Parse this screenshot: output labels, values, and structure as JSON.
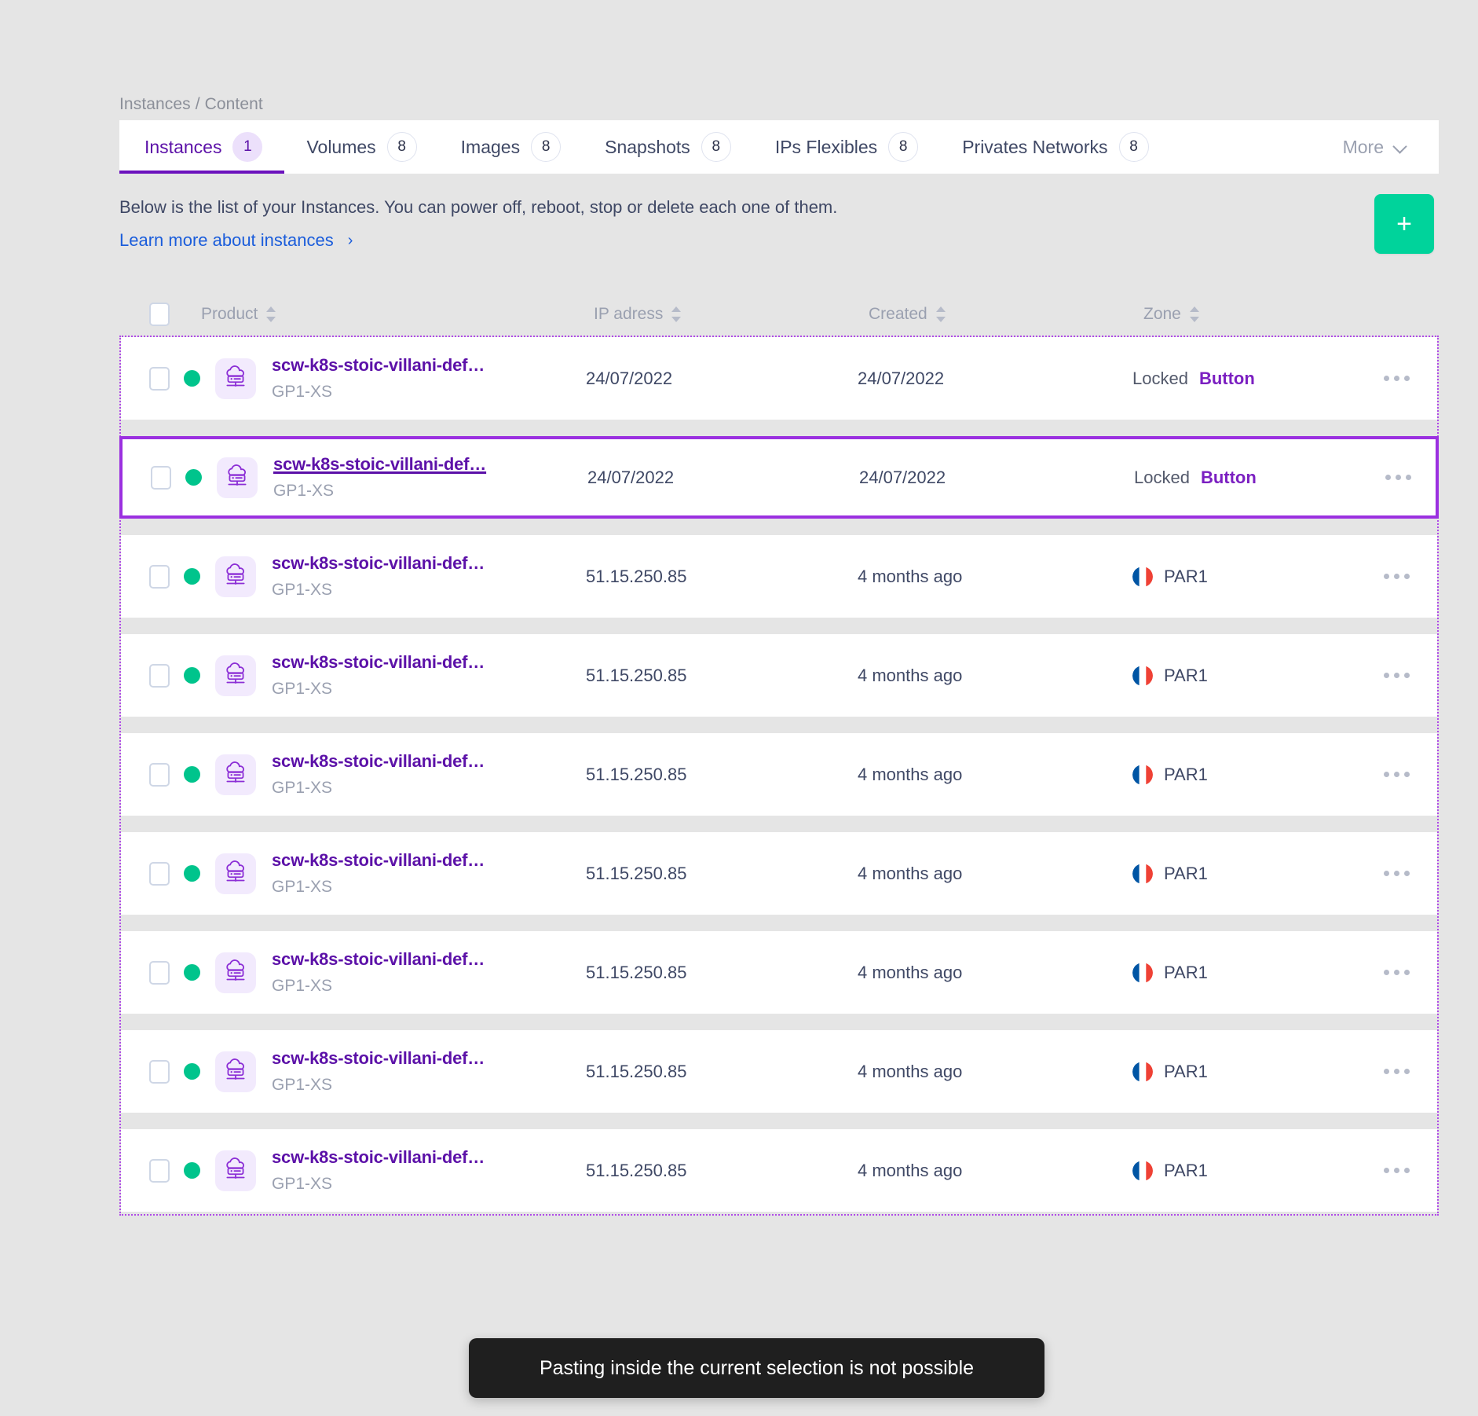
{
  "breadcrumb": "Instances / Content",
  "tabs": [
    {
      "label": "Instances",
      "count": "1",
      "active": true
    },
    {
      "label": "Volumes",
      "count": "8",
      "active": false
    },
    {
      "label": "Images",
      "count": "8",
      "active": false
    },
    {
      "label": "Snapshots",
      "count": "8",
      "active": false
    },
    {
      "label": "IPs Flexibles",
      "count": "8",
      "active": false
    },
    {
      "label": "Privates Networks",
      "count": "8",
      "active": false
    }
  ],
  "more_label": "More",
  "description": "Below is the list of your Instances. You can power off, reboot, stop or delete each one of them.",
  "learn_more": "Learn more about instances",
  "learn_more_arrow": "›",
  "add_button_label": "+",
  "columns": {
    "product": "Product",
    "ip": "IP adress",
    "created": "Created",
    "zone": "Zone"
  },
  "colors": {
    "accent_purple": "#5c11a8",
    "selection_purple": "#9b30e0",
    "status_green": "#00c48c",
    "add_button_green": "#00d39b",
    "link_blue": "#1b5ddb"
  },
  "rows": [
    {
      "name": "scw-k8s-stoic-villani-def…",
      "type": "GP1-XS",
      "ip": "24/07/2022",
      "created": "24/07/2022",
      "zone_locked": "Locked",
      "zone_button": "Button",
      "zone_mode": "locked",
      "selected": false
    },
    {
      "name": "scw-k8s-stoic-villani-def…",
      "type": "GP1-XS",
      "ip": "24/07/2022",
      "created": "24/07/2022",
      "zone_locked": "Locked",
      "zone_button": "Button",
      "zone_mode": "locked",
      "selected": true
    },
    {
      "name": "scw-k8s-stoic-villani-def…",
      "type": "GP1-XS",
      "ip": "51.15.250.85",
      "created": "4 months ago",
      "zone": "PAR1",
      "zone_mode": "region",
      "selected": false
    },
    {
      "name": "scw-k8s-stoic-villani-def…",
      "type": "GP1-XS",
      "ip": "51.15.250.85",
      "created": "4 months ago",
      "zone": "PAR1",
      "zone_mode": "region",
      "selected": false
    },
    {
      "name": "scw-k8s-stoic-villani-def…",
      "type": "GP1-XS",
      "ip": "51.15.250.85",
      "created": "4 months ago",
      "zone": "PAR1",
      "zone_mode": "region",
      "selected": false
    },
    {
      "name": "scw-k8s-stoic-villani-def…",
      "type": "GP1-XS",
      "ip": "51.15.250.85",
      "created": "4 months ago",
      "zone": "PAR1",
      "zone_mode": "region",
      "selected": false
    },
    {
      "name": "scw-k8s-stoic-villani-def…",
      "type": "GP1-XS",
      "ip": "51.15.250.85",
      "created": "4 months ago",
      "zone": "PAR1",
      "zone_mode": "region",
      "selected": false
    },
    {
      "name": "scw-k8s-stoic-villani-def…",
      "type": "GP1-XS",
      "ip": "51.15.250.85",
      "created": "4 months ago",
      "zone": "PAR1",
      "zone_mode": "region",
      "selected": false
    },
    {
      "name": "scw-k8s-stoic-villani-def…",
      "type": "GP1-XS",
      "ip": "51.15.250.85",
      "created": "4 months ago",
      "zone": "PAR1",
      "zone_mode": "region",
      "selected": false
    }
  ],
  "toast": "Pasting inside the current selection is not possible"
}
